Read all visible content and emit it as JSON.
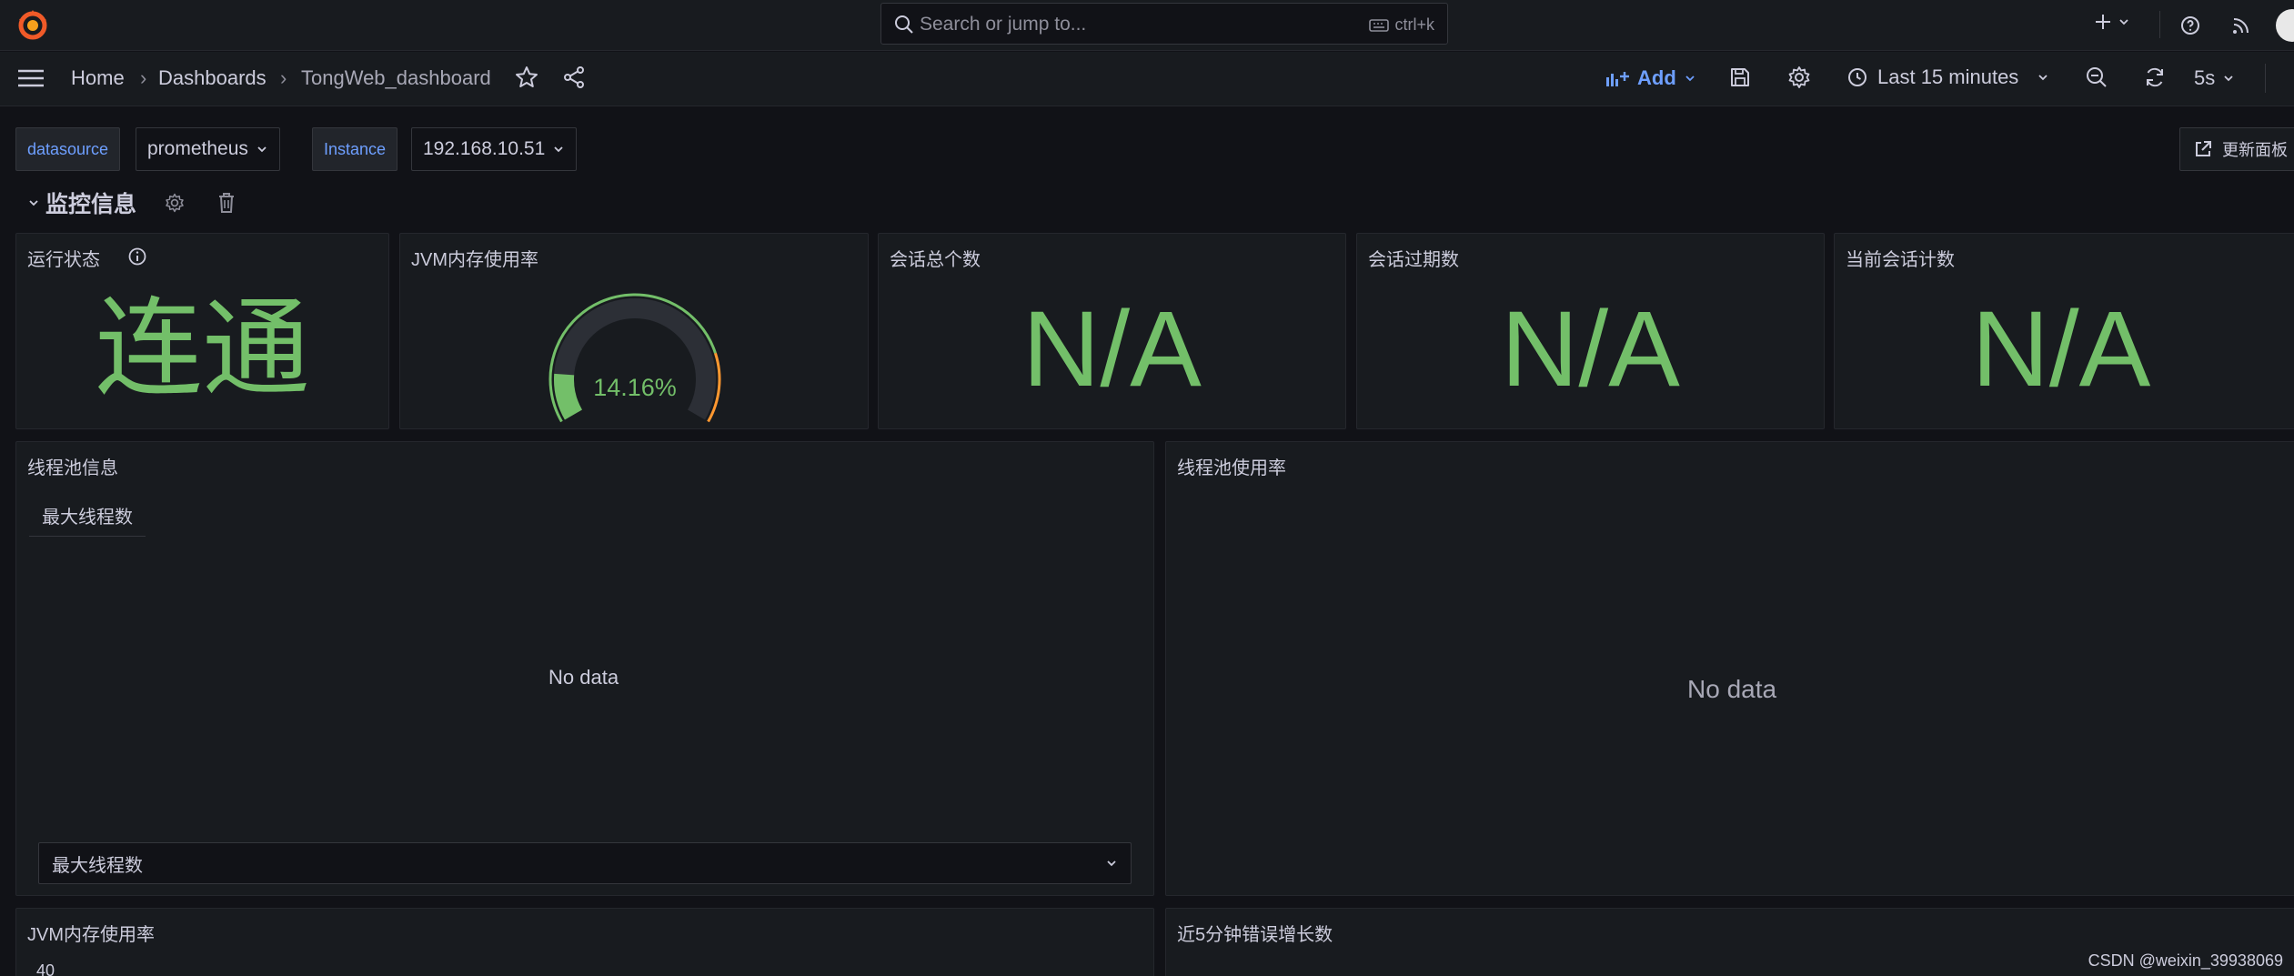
{
  "topbar": {
    "search_placeholder": "Search or jump to...",
    "search_shortcut": "ctrl+k"
  },
  "breadcrumb": {
    "home": "Home",
    "dashboards": "Dashboards",
    "current": "TongWeb_dashboard",
    "separator": "›"
  },
  "toolbar": {
    "add_label": "Add",
    "time_range": "Last 15 minutes",
    "refresh_interval": "5s"
  },
  "variables": {
    "datasource_label": "datasource",
    "datasource_value": "prometheus",
    "instance_label": "Instance",
    "instance_value": "192.168.10.51",
    "update_button": "更新面板"
  },
  "row": {
    "title": "监控信息"
  },
  "panels": {
    "status": {
      "title": "运行状态",
      "value": "连通"
    },
    "jvm_gauge": {
      "title": "JVM内存使用率",
      "value": "14.16%",
      "percent": 14.16
    },
    "sessions_total": {
      "title": "会话总个数",
      "value": "N/A"
    },
    "sessions_expired": {
      "title": "会话过期数",
      "value": "N/A"
    },
    "sessions_current": {
      "title": "当前会话计数",
      "value": "N/A"
    },
    "threadpool_info": {
      "title": "线程池信息",
      "tab": "最大线程数",
      "nodata": "No data",
      "select_value": "最大线程数"
    },
    "threadpool_usage": {
      "title": "线程池使用率",
      "nodata": "No data"
    },
    "jvm_timeseries": {
      "title": "JVM内存使用率",
      "y_tick": "40"
    },
    "errors_5m": {
      "title": "近5分钟错误增长数"
    }
  },
  "watermark": "CSDN @weixin_39938069",
  "colors": {
    "accent": "#6e9fff",
    "value_green": "#73bf69",
    "gauge_orange": "#ff9830",
    "background": "#111217",
    "panel": "#181b1f"
  }
}
